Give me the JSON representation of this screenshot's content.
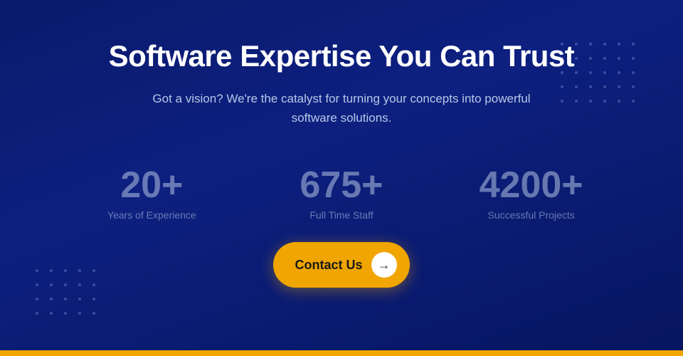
{
  "hero": {
    "title": "Software Expertise You Can Trust",
    "subtitle": "Got a vision? We're the catalyst for turning your concepts into powerful software solutions.",
    "cta_button_label": "Contact Us",
    "cta_arrow": "→"
  },
  "stats": [
    {
      "number": "20+",
      "label": "Years of Experience"
    },
    {
      "number": "675+",
      "label": "Full Time Staff"
    },
    {
      "number": "4200+",
      "label": "Successful Projects"
    }
  ],
  "colors": {
    "bg_dark": "#071560",
    "accent_gold": "#f0a500",
    "text_white": "#ffffff",
    "text_muted": "rgba(180,195,225,0.55)"
  }
}
